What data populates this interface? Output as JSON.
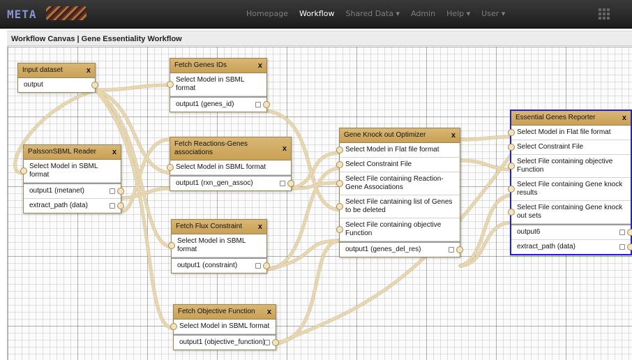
{
  "navbar": {
    "logo": "META",
    "links": [
      "Homepage",
      "Workflow",
      "Shared Data ▾",
      "Admin",
      "Help ▾",
      "User ▾"
    ],
    "active": "Workflow"
  },
  "page_title": "Workflow Canvas | Gene Essentiality Workflow",
  "nodes": {
    "input_dataset": {
      "title": "Input dataset",
      "close": "x",
      "outputs": [
        "output"
      ]
    },
    "palsson": {
      "title": "PalssonSBML Reader",
      "close": "x",
      "inputs": [
        "Select Model in SBML format"
      ],
      "outputs": [
        "output1 (metanet)",
        "extract_path (data)"
      ]
    },
    "fetch_genes": {
      "title": "Fetch Genes IDs",
      "close": "x",
      "inputs": [
        "Select Model in SBML format"
      ],
      "outputs": [
        "output1 (genes_id)"
      ]
    },
    "fetch_reactions": {
      "title": "Fetch Reactions-Genes associations",
      "close": "x",
      "inputs": [
        "Select Model in SBML format"
      ],
      "outputs": [
        "output1 (rxn_gen_assoc)"
      ]
    },
    "fetch_flux": {
      "title": "Fetch Flux Constraint",
      "close": "x",
      "inputs": [
        "Select Model in SBML format"
      ],
      "outputs": [
        "output1 (constraint)"
      ]
    },
    "fetch_objective": {
      "title": "Fetch Objective Function",
      "close": "x",
      "inputs": [
        "Select Model in SBML format"
      ],
      "outputs": [
        "output1 (objective_function)"
      ]
    },
    "optimizer": {
      "title": "Gene Knock out Optimizer",
      "close": "x",
      "inputs": [
        "Select Model in Flat file format",
        "Select Constraint File",
        "Select File containing Reaction-Gene Associations",
        "Select File cantaining list of Genes to be deleted",
        "Select File containing objective Function"
      ],
      "outputs": [
        "output1 (genes_del_res)"
      ]
    },
    "reporter": {
      "title": "Essential Genes Reporter",
      "close": "x",
      "inputs": [
        "Select Model in Flat file format",
        "Select Constraint File",
        "Select File containing objective Function",
        "Select File containing Gene knock results",
        "Select File containing Gene knock out sets"
      ],
      "outputs": [
        "output6",
        "extract_path (data)"
      ]
    }
  },
  "colors": {
    "node_header": "#d4ad65",
    "selected_border": "#2222cc",
    "connector": "#e8d7ae"
  }
}
